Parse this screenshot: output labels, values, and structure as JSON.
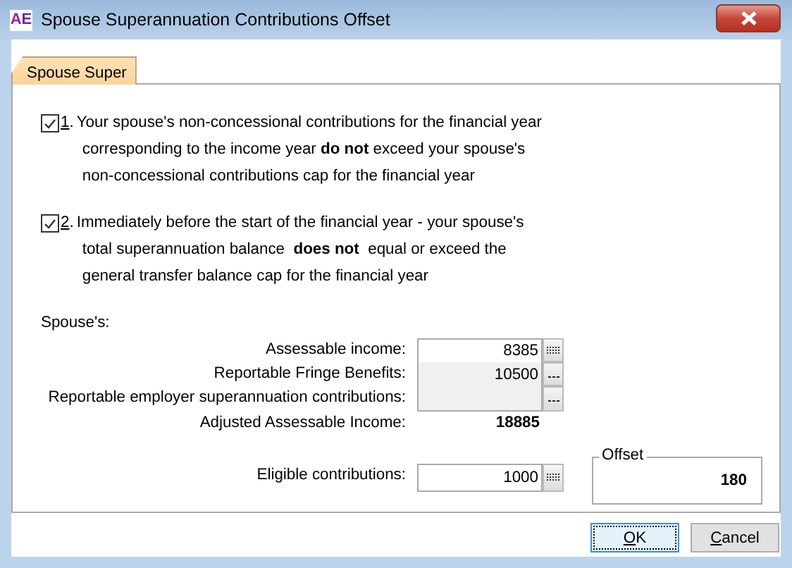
{
  "window": {
    "title": "Spouse Superannuation Contributions Offset",
    "app_badge": "AE"
  },
  "tabs": [
    {
      "label": "Spouse Super",
      "selected": true
    }
  ],
  "conditions": [
    {
      "number": "1",
      "separator": ".",
      "checked": true,
      "lines": [
        "Your spouse's non-concessional contributions for the financial year",
        "corresponding to the income year **do not** exceed your spouse's",
        "non-concessional contributions cap for the financial year"
      ]
    },
    {
      "number": "2",
      "separator": ".",
      "checked": true,
      "lines": [
        "Immediately before the start of the financial year - your spouse's",
        "total superannuation balance  **does not**  equal or exceed the",
        "general transfer balance cap for the financial year"
      ]
    }
  ],
  "section_label": "Spouse's:",
  "income_fields": [
    {
      "label": "Assessable income:",
      "value": "8385",
      "disabled": false,
      "kind": "calculator"
    },
    {
      "label": "Reportable Fringe Benefits:",
      "value": "10500",
      "disabled": true,
      "kind": "ellipsis"
    },
    {
      "label": "Reportable employer superannuation contributions:",
      "disabled": true,
      "kind": "ellipsis"
    }
  ],
  "adjusted": {
    "label": "Adjusted Assessable Income:",
    "value": "18885"
  },
  "eligible": {
    "label": "Eligible contributions:",
    "value": "1000",
    "disabled": false,
    "kind": "calculator"
  },
  "offset": {
    "legend": "Offset",
    "value": "180"
  },
  "buttons": [
    {
      "access_key": "O",
      "label_rest": "K",
      "default": true
    },
    {
      "access_key": "C",
      "label_rest": "ancel",
      "default": false
    }
  ]
}
